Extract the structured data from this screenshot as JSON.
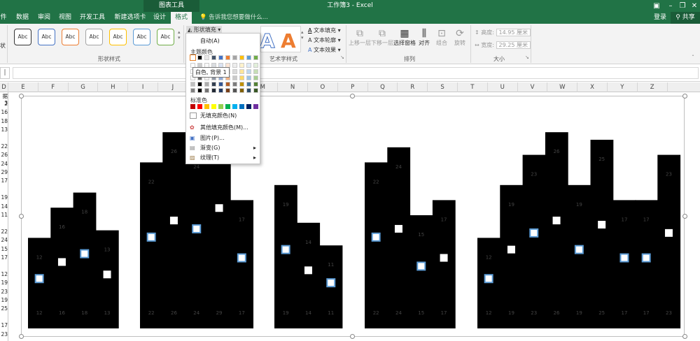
{
  "titlebar": {
    "context_tab": "图表工具",
    "document_title": "工作簿3 - Excel"
  },
  "tabs": [
    "件",
    "数据",
    "审阅",
    "视图",
    "开发工具",
    "新建选项卡",
    "设计",
    "格式"
  ],
  "active_tab": "格式",
  "tellme": "告诉我您想要做什么...",
  "account": {
    "login": "登录",
    "share": "共享"
  },
  "ribbon": {
    "partial_left": "状",
    "shape_style_sample": "Abc",
    "shape_styles_label": "形状样式",
    "shape_fill": "形状填充",
    "wordart_sample": "A",
    "wordart_label": "艺术字样式",
    "text_fill": "文本填充",
    "text_outline": "文本轮廓",
    "text_effects": "文本效果",
    "bring_forward": "上移一层",
    "send_backward": "下移一层",
    "selection_pane": "选择窗格",
    "align": "对齐",
    "group": "组合",
    "rotate": "旋转",
    "arrange_label": "排列",
    "height_label": "高度:",
    "height_value": "14.95 厘米",
    "width_label": "宽度:",
    "width_value": "29.25 厘米",
    "size_label": "大小"
  },
  "dropdown": {
    "auto": "自动(A)",
    "theme_colors": "主题颜色",
    "standard_colors": "标准色",
    "no_fill": "无填充颜色(N)",
    "more_colors": "其他填充颜色(M)...",
    "picture": "图片(P)...",
    "gradient": "渐变(G)",
    "texture": "纹理(T)",
    "tooltip": "白色, 背景 1"
  },
  "colors": {
    "accent": "#217346",
    "theme_top": [
      "#ffffff",
      "#000000",
      "#e7e6e6",
      "#44546a",
      "#4472c4",
      "#ed7d31",
      "#a5a5a5",
      "#ffc000",
      "#5b9bd5",
      "#70ad47"
    ],
    "standard": [
      "#c00000",
      "#ff0000",
      "#ffc000",
      "#ffff00",
      "#92d050",
      "#00b050",
      "#00b0f0",
      "#0070c0",
      "#002060",
      "#7030a0"
    ]
  },
  "columns": [
    "D",
    "E",
    "F",
    "G",
    "H",
    "I",
    "J",
    "K",
    "L",
    "M",
    "N",
    "O",
    "P",
    "Q",
    "R",
    "S",
    "T",
    "U",
    "V",
    "W",
    "X",
    "Y",
    "Z"
  ],
  "row_values": [
    "据3",
    "2",
    "16",
    "18",
    "13",
    "",
    "22",
    "26",
    "24",
    "29",
    "17",
    "",
    "19",
    "14",
    "11",
    "",
    "22",
    "24",
    "15",
    "17",
    "",
    "12",
    "19",
    "23",
    "19",
    "25",
    "",
    "17",
    "23"
  ],
  "chart_data": {
    "type": "bar",
    "groups": [
      {
        "values": [
          12,
          16,
          18,
          13
        ]
      },
      {
        "values": [
          22,
          26,
          24,
          29,
          17
        ]
      },
      {
        "values": [
          19,
          14,
          11
        ]
      },
      {
        "values": [
          22,
          24,
          15,
          17
        ]
      },
      {
        "values": [
          12,
          19,
          23,
          26,
          19,
          25,
          17
        ]
      },
      {
        "values": [
          17,
          23
        ]
      }
    ],
    "ylim": [
      0,
      30
    ],
    "bar_color": "#000000",
    "label_color": "#444444"
  }
}
